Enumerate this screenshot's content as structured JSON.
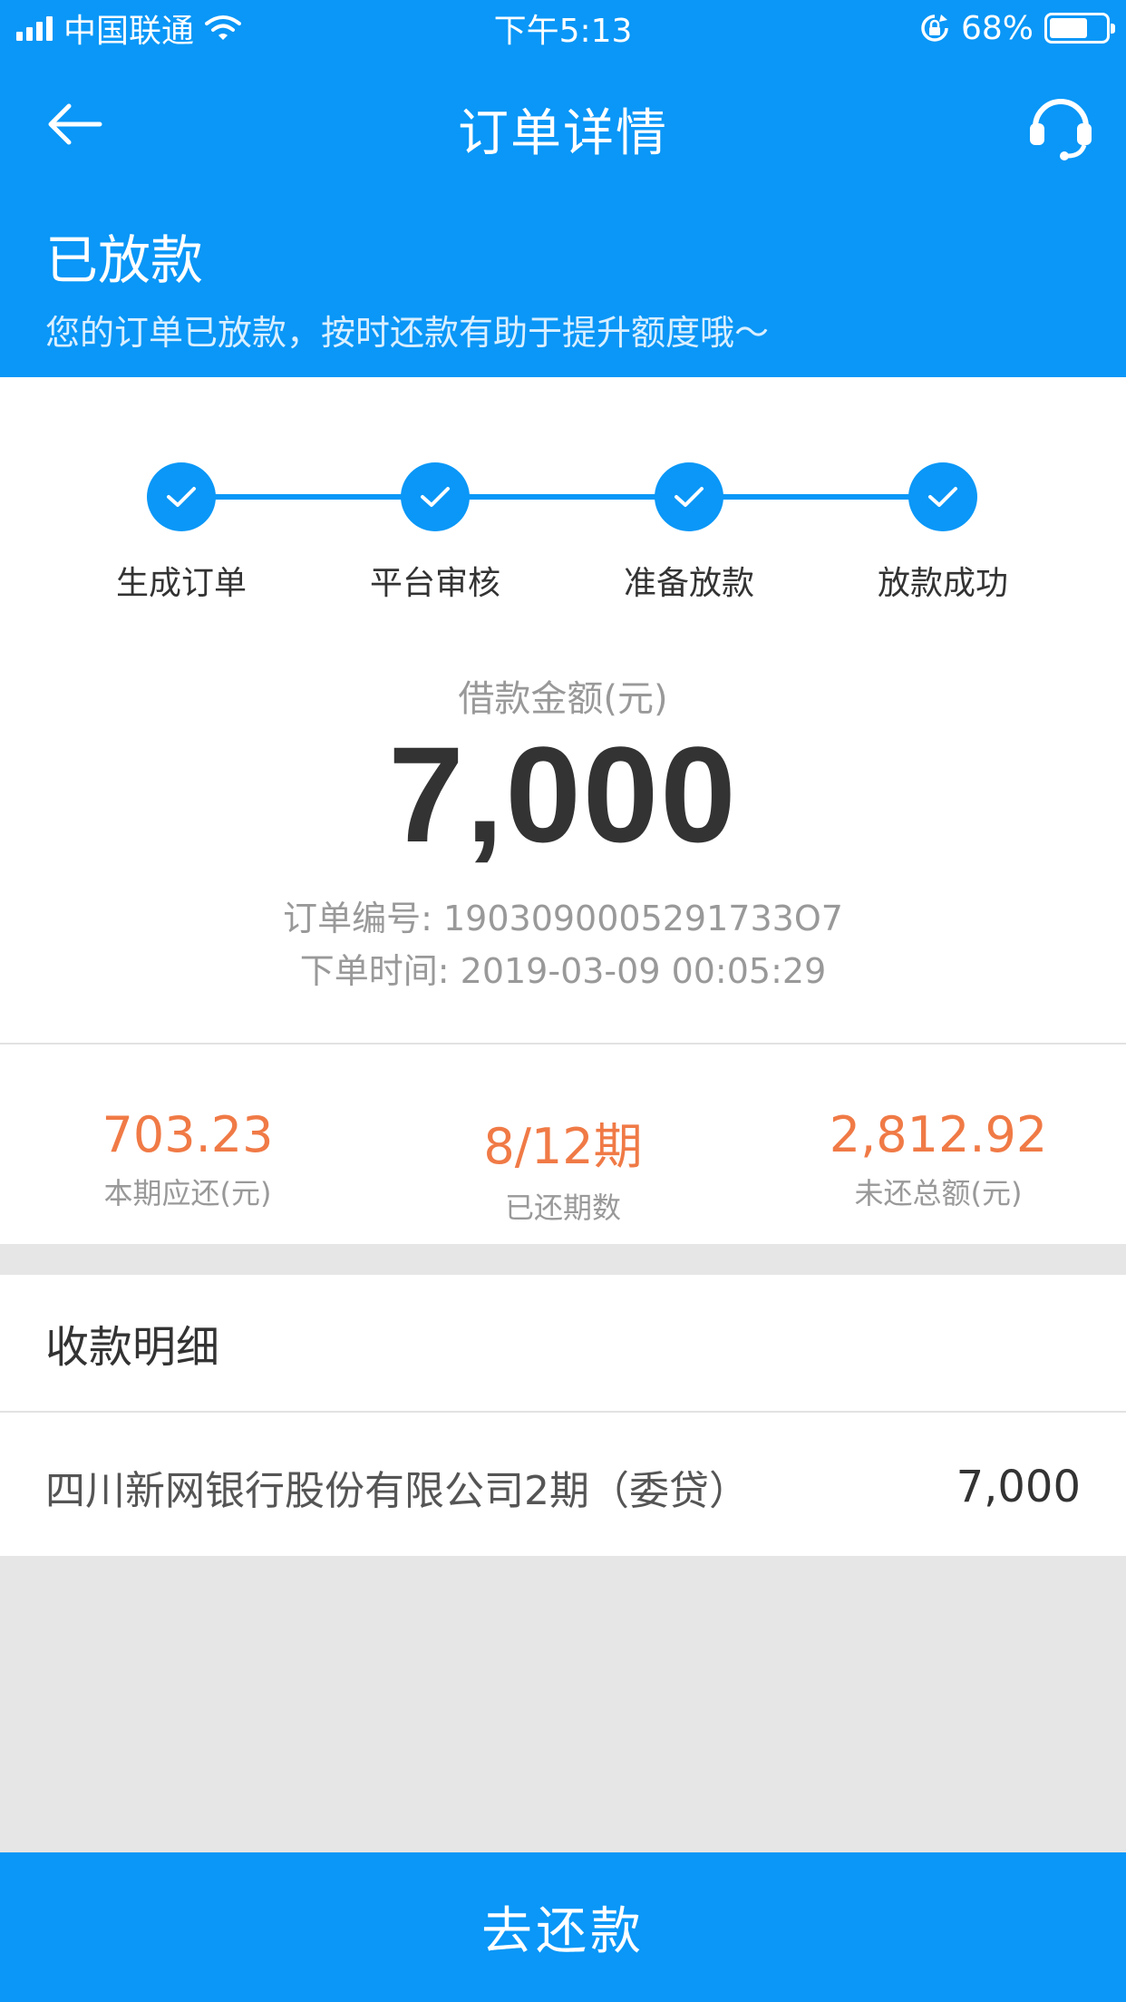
{
  "status_bar": {
    "carrier": "中国联通",
    "time": "下午5:13",
    "battery_percent": "68%",
    "battery_level": 0.68,
    "icons": [
      "signal-icon",
      "wifi-icon",
      "rotation-lock-icon",
      "battery-icon"
    ]
  },
  "nav": {
    "title": "订单详情",
    "back_icon": "back-arrow-icon",
    "service_icon": "headset-icon"
  },
  "header": {
    "status": "已放款",
    "subtitle": "您的订单已放款，按时还款有助于提升额度哦～"
  },
  "progress": {
    "steps": [
      {
        "label": "生成订单",
        "done": true
      },
      {
        "label": "平台审核",
        "done": true
      },
      {
        "label": "准备放款",
        "done": true
      },
      {
        "label": "放款成功",
        "done": true
      }
    ]
  },
  "loan": {
    "amount_label": "借款金额(元)",
    "amount": "7,000",
    "order_no_label": "订单编号:",
    "order_no": "1903090005291733O7",
    "order_time_label": "下单时间:",
    "order_time": "2019-03-09 00:05:29"
  },
  "stats": [
    {
      "value": "703.23",
      "label": "本期应还(元)"
    },
    {
      "value": "8/12期",
      "label": "已还期数"
    },
    {
      "value": "2,812.92",
      "label": "未还总额(元)"
    }
  ],
  "receipt": {
    "title": "收款明细",
    "items": [
      {
        "name": "四川新网银行股份有限公司2期（委贷）",
        "amount": "7,000"
      }
    ]
  },
  "repay_button": "去还款",
  "colors": {
    "primary": "#0a97f7",
    "accent": "#f07a46",
    "background": "#e6e6e6"
  }
}
